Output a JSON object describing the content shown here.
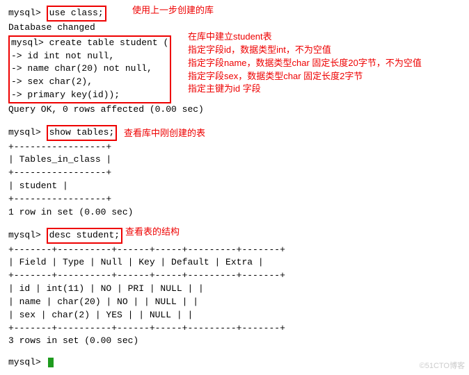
{
  "prompt": "mysql>",
  "cont": "    ->",
  "cmd1": "use class;",
  "note1": "使用上一步创建的库",
  "resp1": "Database changed",
  "cmd2_l1": "create table student (",
  "cmd2_l2": "id int not null,",
  "cmd2_l3": "name char(20) not null,",
  "cmd2_l4": "sex char(2),",
  "cmd2_l5": "primary key(id));",
  "noteblock2": {
    "l1": "在库中建立student表",
    "l2": "指定字段id，数据类型int，不为空值",
    "l3": "指定字段name，数据类型char 固定长度20字节，不为空值",
    "l4": "指定字段sex，数据类型char 固定长度2字节",
    "l5": "指定主键为id 字段"
  },
  "resp2": "Query OK, 0 rows affected (0.00 sec)",
  "cmd3": "show tables;",
  "note3": "查看库中刚创建的表",
  "tbl_border1": "+-----------------+",
  "tbl_header": "| Tables_in_class |",
  "tbl_row": "| student         |",
  "resp3": "1 row in set (0.00 sec)",
  "cmd4": "desc student;",
  "note4": "查看表的结构",
  "desc_border": "+-------+----------+------+-----+---------+-------+",
  "desc_header": "| Field | Type     | Null | Key | Default | Extra |",
  "desc_r1": "| id    | int(11)  | NO   | PRI | NULL    |       |",
  "desc_r2": "| name  | char(20) | NO   |     | NULL    |       |",
  "desc_r3": "| sex   | char(2)  | YES  |     | NULL    |       |",
  "resp4": "3 rows in set (0.00 sec)",
  "watermark": "©51CTO博客",
  "chart_data": {
    "type": "table",
    "title": "desc student",
    "columns": [
      "Field",
      "Type",
      "Null",
      "Key",
      "Default",
      "Extra"
    ],
    "rows": [
      [
        "id",
        "int(11)",
        "NO",
        "PRI",
        "NULL",
        ""
      ],
      [
        "name",
        "char(20)",
        "NO",
        "",
        "NULL",
        ""
      ],
      [
        "sex",
        "char(2)",
        "YES",
        "",
        "NULL",
        ""
      ]
    ]
  }
}
